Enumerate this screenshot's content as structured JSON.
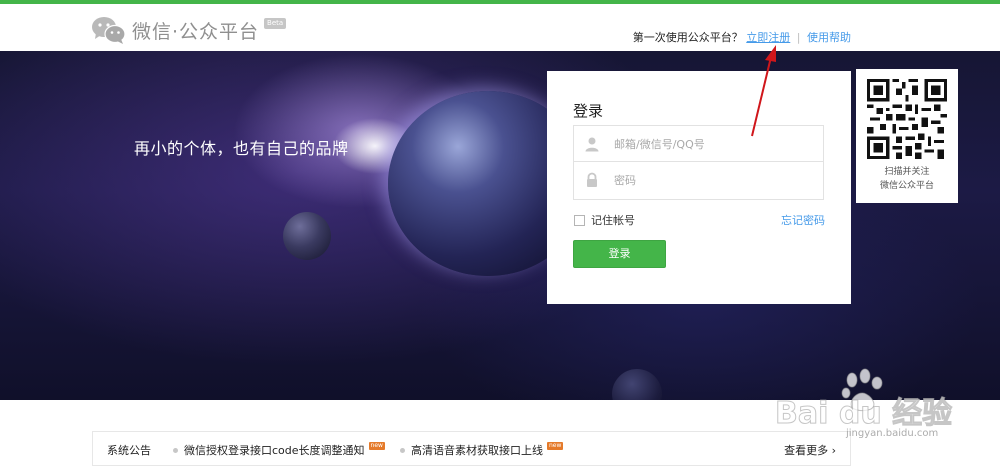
{
  "header": {
    "logo_text": "微信·公众平台",
    "beta": "Beta",
    "first_time": "第一次使用公众平台？",
    "register_link": "立即注册",
    "separator": "|",
    "help_link": "使用帮助"
  },
  "banner": {
    "slogan": "再小的个体，也有自己的品牌"
  },
  "login": {
    "title": "登录",
    "username_placeholder": "邮箱/微信号/QQ号",
    "password_placeholder": "密码",
    "remember_label": "记住帐号",
    "forgot_link": "忘记密码",
    "submit_label": "登录"
  },
  "qr": {
    "caption_line1": "扫描并关注",
    "caption_line2": "微信公众平台"
  },
  "notice": {
    "title": "系统公告",
    "items": [
      {
        "text": "微信授权登录接口code长度调整通知",
        "badge": "new"
      },
      {
        "text": "高清语音素材获取接口上线",
        "badge": "new"
      }
    ],
    "more_link": "查看更多 ›"
  },
  "watermark": {
    "text": "Bai du 经验",
    "url": "jingyan.baidu.com"
  },
  "colors": {
    "accent_green": "#44b549",
    "link_blue": "#459ae9",
    "annotation_red": "#d0161b"
  },
  "icons": [
    "wechat-logo-icon",
    "user-icon",
    "lock-icon",
    "qr-code-icon",
    "red-arrow-annotation"
  ]
}
